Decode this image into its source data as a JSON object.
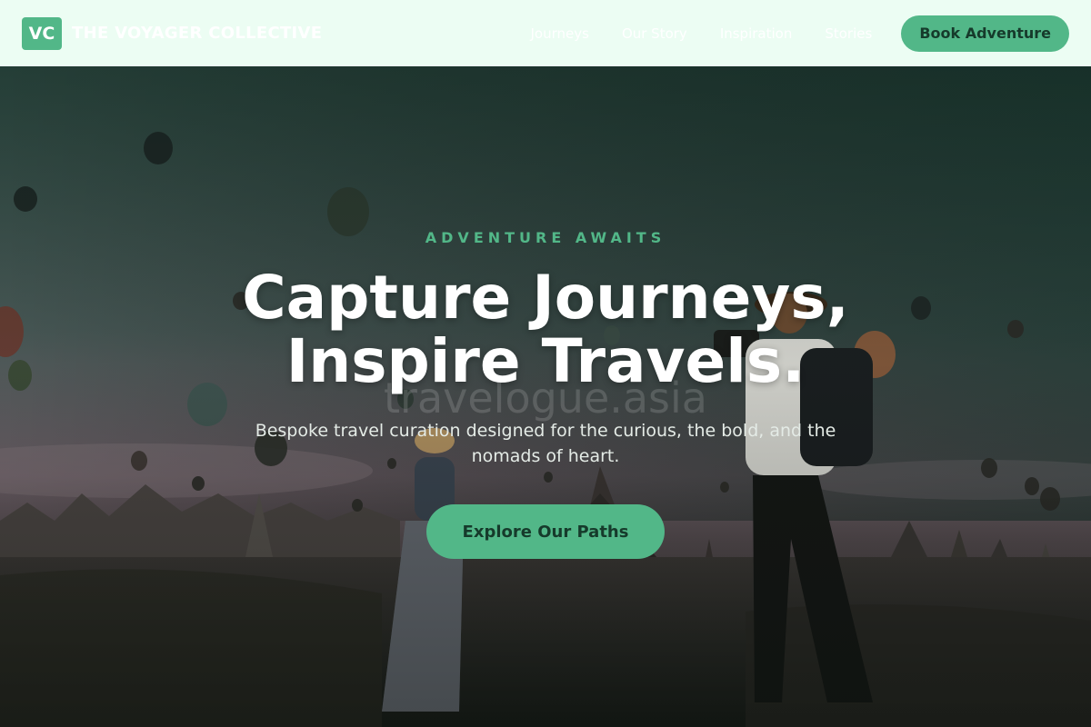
{
  "header": {
    "logo_mark": "VC",
    "logo_text": "THE VOYAGER COLLECTIVE",
    "nav": [
      {
        "label": "Journeys"
      },
      {
        "label": "Our Story"
      },
      {
        "label": "Inspiration"
      },
      {
        "label": "Stories"
      }
    ],
    "cta_label": "Book Adventure"
  },
  "hero": {
    "eyebrow": "ADVENTURE AWAITS",
    "headline_line1": "Capture Journeys,",
    "headline_line2": "Inspire Travels.",
    "watermark": "travelogue.asia",
    "subtext": "Bespoke travel curation designed for the curious, the bold, and the nomads of heart.",
    "button_label": "Explore Our Paths"
  },
  "colors": {
    "accent": "#52b788",
    "header_bg": "#ecfdf3",
    "button_text": "#163a2b"
  }
}
